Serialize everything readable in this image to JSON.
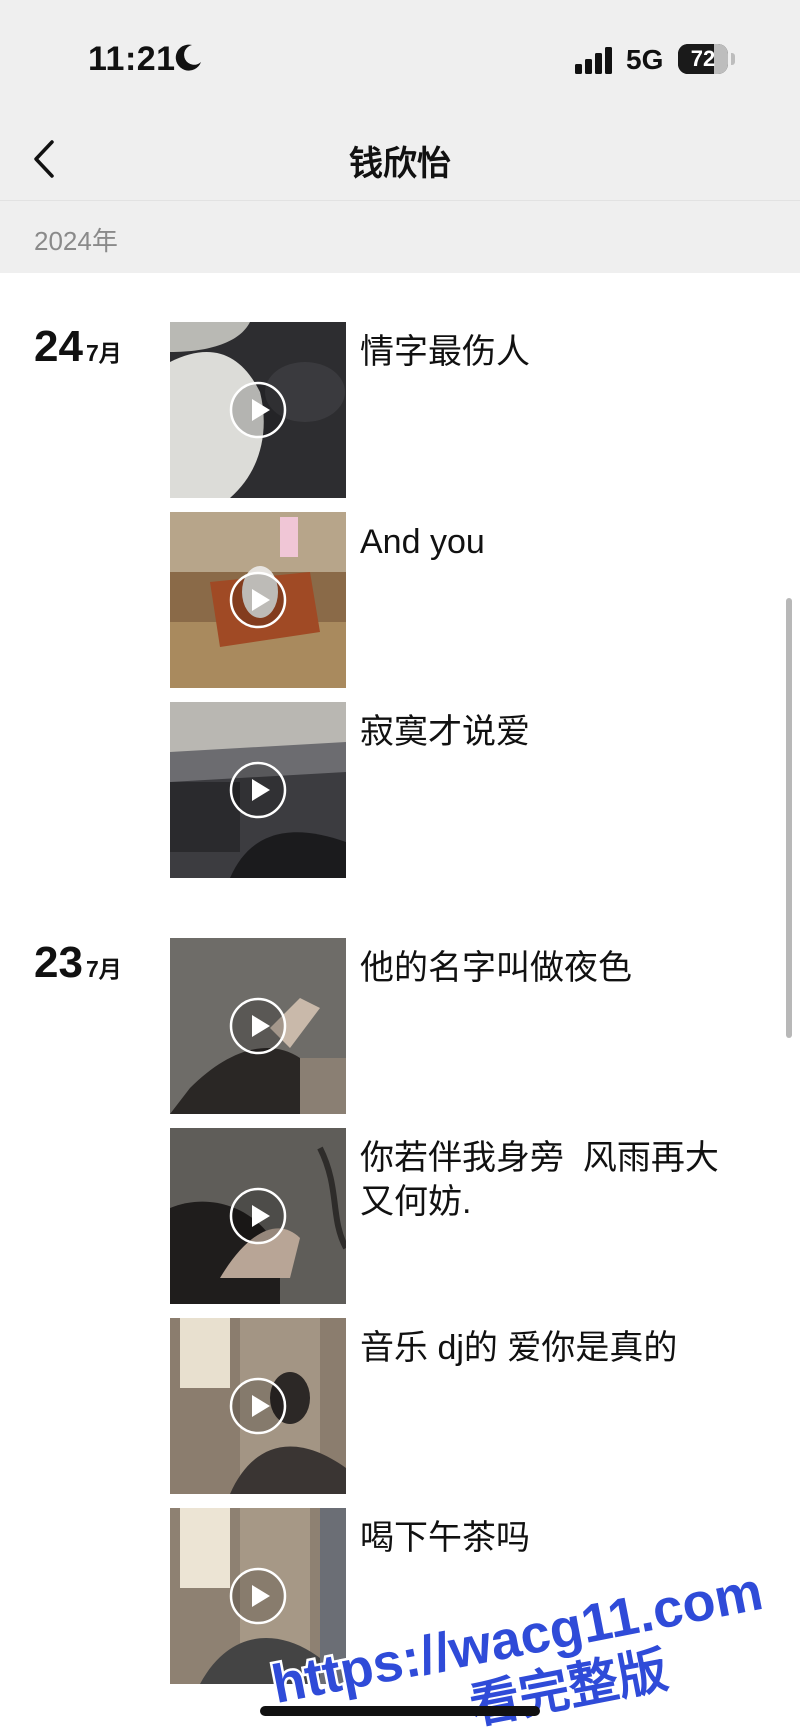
{
  "status_bar": {
    "time": "11:21",
    "network": "5G",
    "battery_percent": "72",
    "battery_level": 0.72
  },
  "nav": {
    "title": "钱欣怡"
  },
  "year_header": "2024年",
  "groups": [
    {
      "day": "24",
      "month": "7月",
      "posts": [
        {
          "caption": "情字最伤人",
          "icon": "play-icon"
        },
        {
          "caption": "And you",
          "icon": "play-icon"
        },
        {
          "caption": "寂寞才说爱",
          "icon": "play-icon"
        }
      ]
    },
    {
      "day": "23",
      "month": "7月",
      "posts": [
        {
          "caption": "他的名字叫做夜色",
          "icon": "play-icon"
        },
        {
          "caption": "你若伴我身旁  风雨再大又何妨.",
          "icon": "play-icon"
        },
        {
          "caption": "音乐 dj的 爱你是真的",
          "icon": "play-icon"
        },
        {
          "caption": "喝下午茶吗",
          "icon": "play-icon"
        }
      ]
    }
  ],
  "watermark": {
    "line1": "https://wacg11.com",
    "line2": "看完整版",
    "color": "#2f4bd8"
  }
}
